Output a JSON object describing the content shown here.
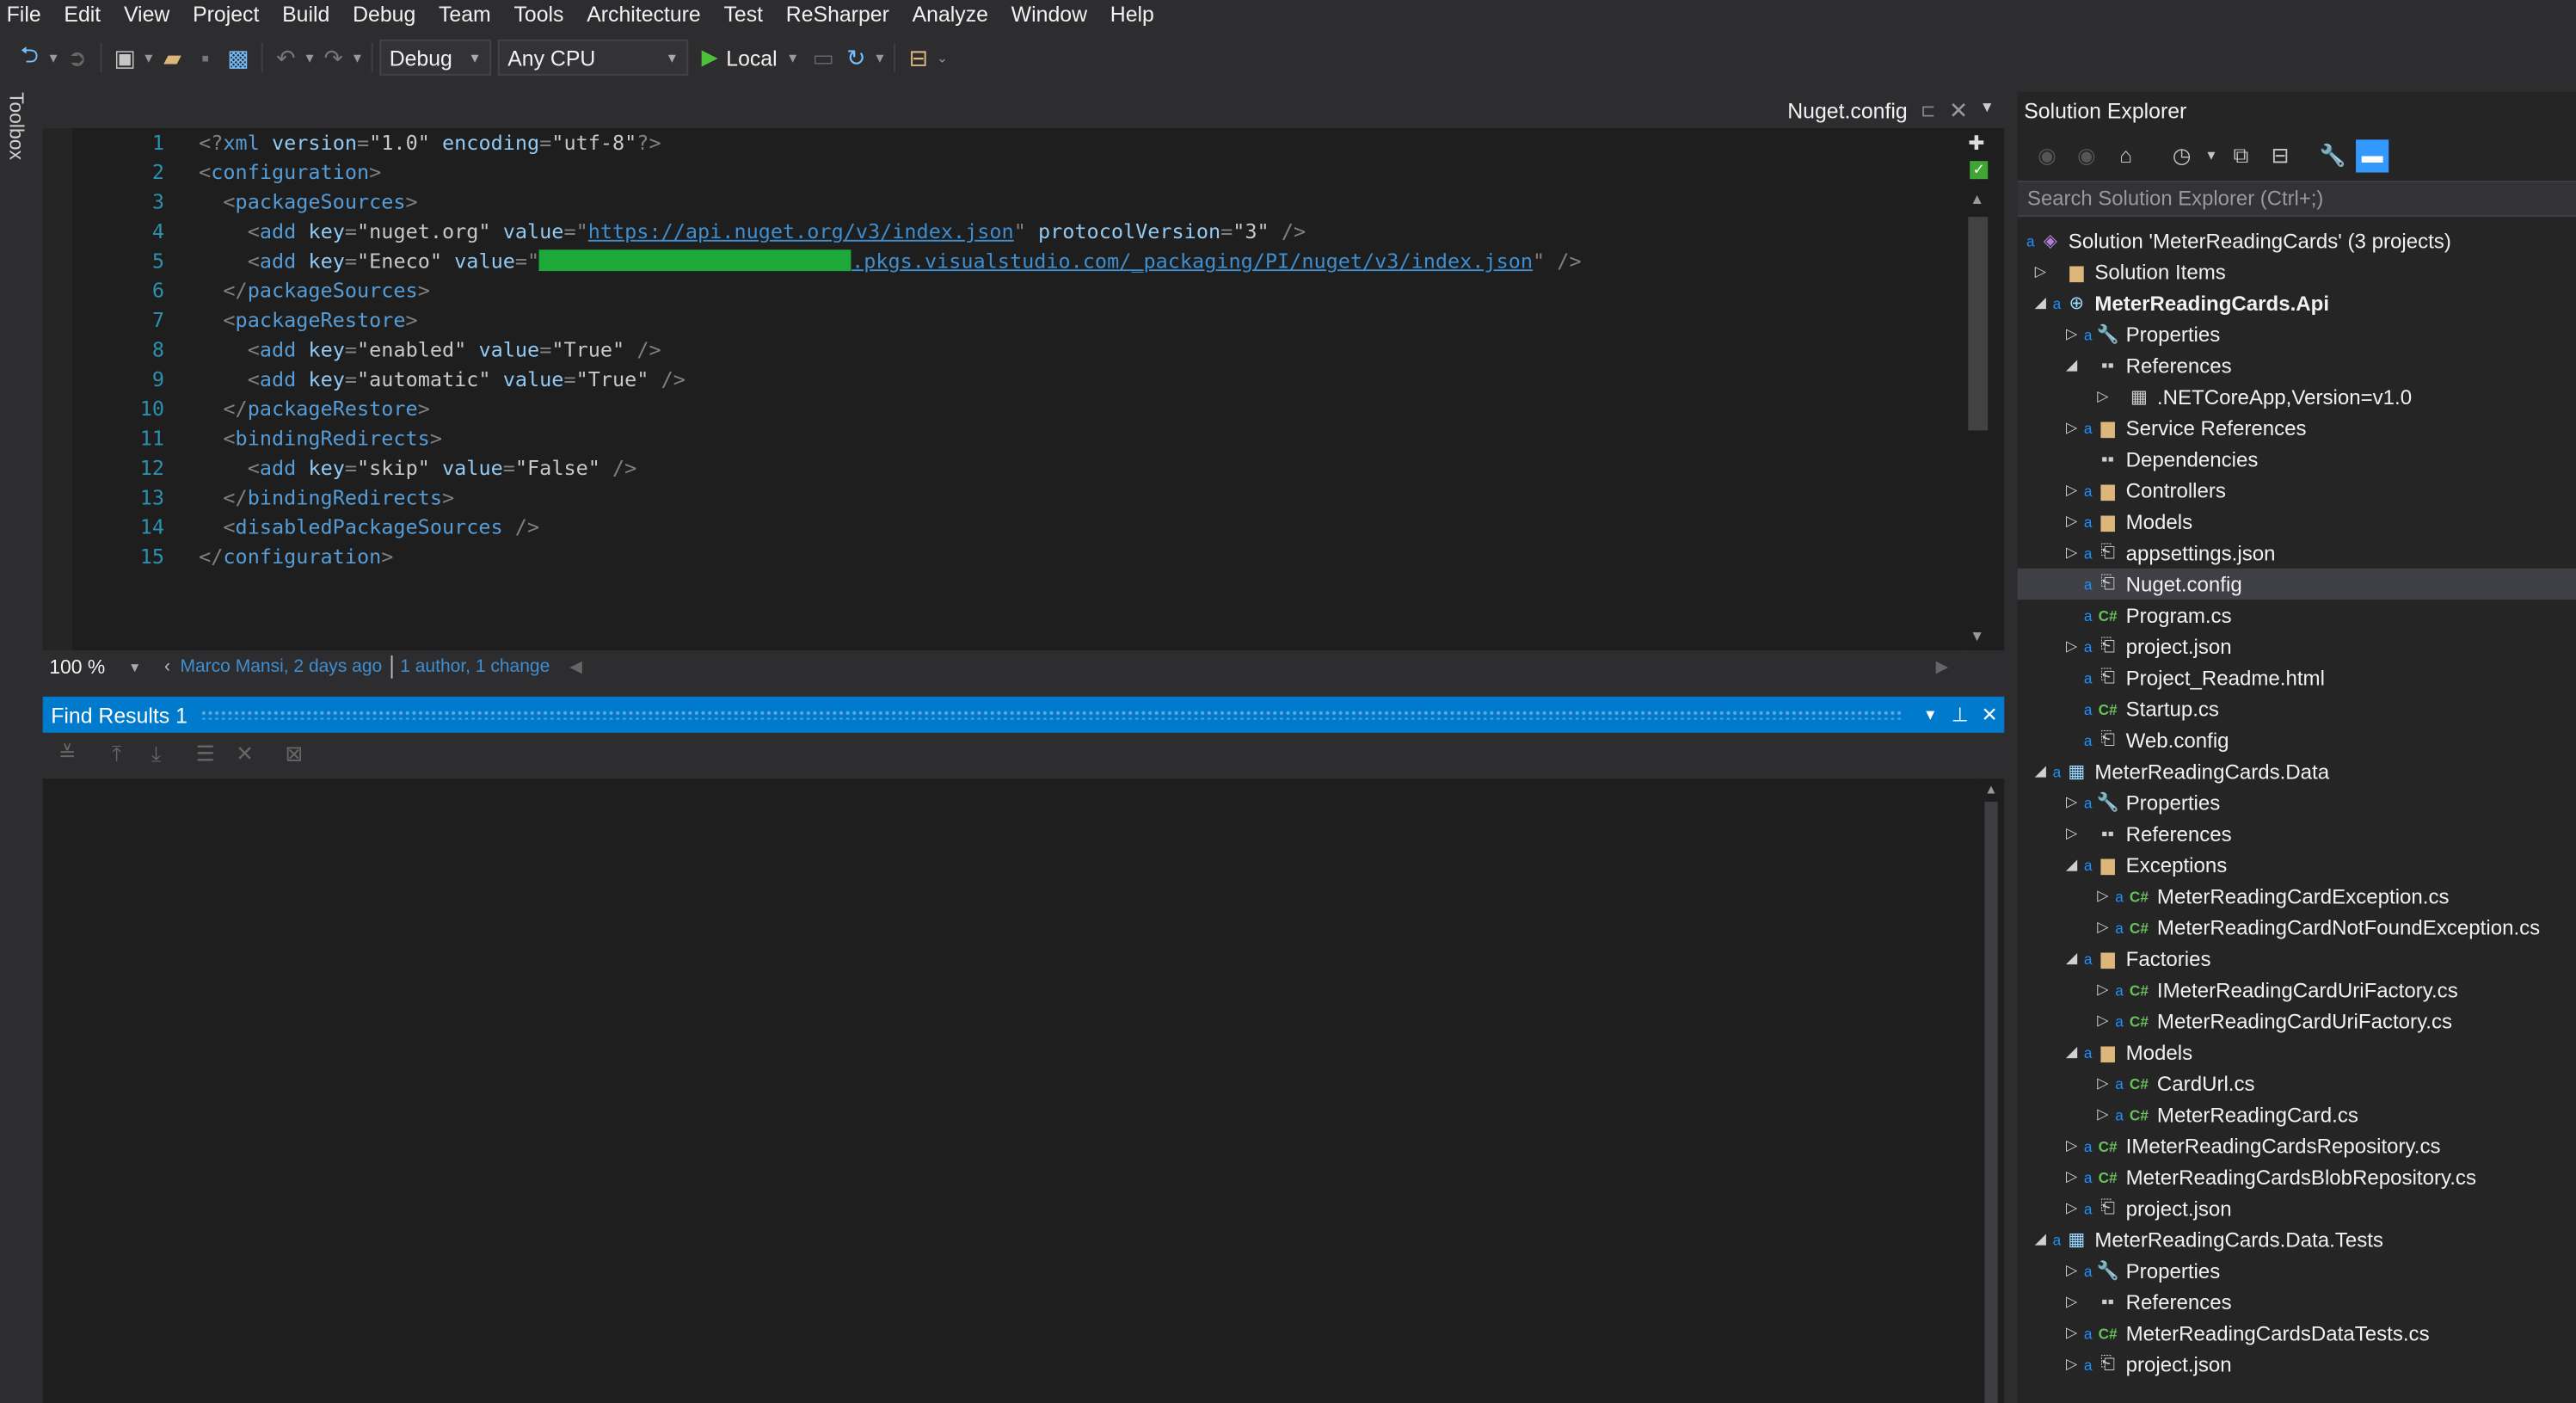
{
  "menu": [
    "File",
    "Edit",
    "View",
    "Project",
    "Build",
    "Debug",
    "Team",
    "Tools",
    "Architecture",
    "Test",
    "ReSharper",
    "Analyze",
    "Window",
    "Help"
  ],
  "toolbar": {
    "configuration": "Debug",
    "platform": "Any CPU",
    "run_target": "Local"
  },
  "toolbox": {
    "label": "Toolbox"
  },
  "editor": {
    "tab_title": "Nuget.config",
    "lines": [
      {
        "n": "1"
      },
      {
        "n": "2"
      },
      {
        "n": "3"
      },
      {
        "n": "4"
      },
      {
        "n": "5"
      },
      {
        "n": "6"
      },
      {
        "n": "7"
      },
      {
        "n": "8"
      },
      {
        "n": "9"
      },
      {
        "n": "10"
      },
      {
        "n": "11"
      },
      {
        "n": "12"
      },
      {
        "n": "13"
      },
      {
        "n": "14"
      },
      {
        "n": "15"
      }
    ],
    "xml": {
      "decl_version": "\"1.0\"",
      "decl_encoding": "\"utf-8\"",
      "nuget_key": "\"nuget.org\"",
      "nuget_url": "https://api.nuget.org/v3/index.json",
      "protocol_version": "\"3\"",
      "eneco_key": "\"Eneco\"",
      "eneco_url_suffix": ".pkgs.visualstudio.com/_packaging/PI/nuget/v3/index.json",
      "enabled_key": "\"enabled\"",
      "enabled_value": "\"True\"",
      "automatic_key": "\"automatic\"",
      "automatic_value": "\"True\"",
      "skip_key": "\"skip\"",
      "skip_value": "\"False\""
    },
    "zoom": "100 %",
    "codelens_author": "Marco Mansi, 2 days ago",
    "codelens_changes": "1 author, 1 change"
  },
  "find_results": {
    "title": "Find Results 1"
  },
  "solution_explorer": {
    "title": "Solution Explorer",
    "search_placeholder": "Search Solution Explorer (Ctrl+;)",
    "items": [
      {
        "label": "Solution 'MeterReadingCards' (3 projects)"
      },
      {
        "label": "Solution Items"
      },
      {
        "label": "MeterReadingCards.Api"
      },
      {
        "label": "Properties"
      },
      {
        "label": "References"
      },
      {
        "label": ".NETCoreApp,Version=v1.0"
      },
      {
        "label": "Service References"
      },
      {
        "label": "Dependencies"
      },
      {
        "label": "Controllers"
      },
      {
        "label": "Models"
      },
      {
        "label": "appsettings.json"
      },
      {
        "label": "Nuget.config"
      },
      {
        "label": "Program.cs"
      },
      {
        "label": "project.json"
      },
      {
        "label": "Project_Readme.html"
      },
      {
        "label": "Startup.cs"
      },
      {
        "label": "Web.config"
      },
      {
        "label": "MeterReadingCards.Data"
      },
      {
        "label": "Properties"
      },
      {
        "label": "References"
      },
      {
        "label": "Exceptions"
      },
      {
        "label": "MeterReadingCardException.cs"
      },
      {
        "label": "MeterReadingCardNotFoundException.cs"
      },
      {
        "label": "Factories"
      },
      {
        "label": "IMeterReadingCardUriFactory.cs"
      },
      {
        "label": "MeterReadingCardUriFactory.cs"
      },
      {
        "label": "Models"
      },
      {
        "label": "CardUrl.cs"
      },
      {
        "label": "MeterReadingCard.cs"
      },
      {
        "label": "IMeterReadingCardsRepository.cs"
      },
      {
        "label": "MeterReadingCardsBlobRepository.cs"
      },
      {
        "label": "project.json"
      },
      {
        "label": "MeterReadingCards.Data.Tests"
      },
      {
        "label": "Properties"
      },
      {
        "label": "References"
      },
      {
        "label": "MeterReadingCardsDataTests.cs"
      },
      {
        "label": "project.json"
      }
    ]
  }
}
